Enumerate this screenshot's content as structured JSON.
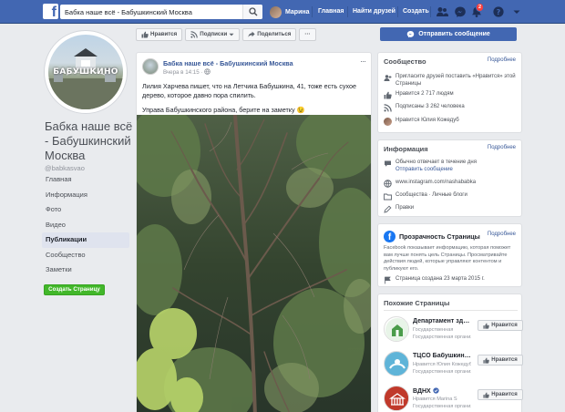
{
  "topbar": {
    "logo": "f",
    "search_value": "Бабка наше всё - Бабушкинский Москва",
    "user_name": "Марина",
    "nav_home": "Главная",
    "nav_find_friends": "Найти друзей",
    "nav_create": "Создать",
    "notifications_count": "2",
    "colors": {
      "bar": "#4267b2",
      "badge": "#fa3e3e"
    }
  },
  "page": {
    "name": "Бабка наше всё - Бабушкинский Москва",
    "handle": "@babkasvao",
    "profile_brand": "БАБУШКИНО",
    "left_nav": [
      {
        "label": "Главная"
      },
      {
        "label": "Информация"
      },
      {
        "label": "Фото"
      },
      {
        "label": "Видео"
      },
      {
        "label": "Публикации",
        "active": true
      },
      {
        "label": "Сообщество"
      },
      {
        "label": "Заметки"
      }
    ],
    "create_page": "Создать Страницу"
  },
  "actions": {
    "like": "Нравится",
    "subscriptions": "Подписки",
    "share": "Поделиться",
    "more": "···",
    "send_message": "Отправить сообщение"
  },
  "post": {
    "author": "Бабка наше всё - Бабушкинский Москва",
    "time": "Вчера в 14:15 ·",
    "text1": "Лилия Харчева пишет, что на Летчика Бабушкина, 41, тоже есть сухое дерево, которое давно пора спилить.",
    "text2": "Управа Бабушкинского района, берите на заметку 😉",
    "more": "···"
  },
  "community": {
    "title": "Сообщество",
    "more": "Подробнее",
    "invite": "Пригласите друзей поставить «Нравится» этой Страницы",
    "likes": "Нравится 2 717 людям",
    "followers": "Подписаны 3 262 человека",
    "liked_by": "Нравится Юлия Кожедуб"
  },
  "info": {
    "title": "Информация",
    "more": "Подробнее",
    "response": "Обычно отвечает в течение дня",
    "send_message": "Отправить сообщение",
    "instagram": "www.instagram.com/nashababka",
    "categories": "Сообщества · Личные блоги",
    "edits": "Правки"
  },
  "transparency": {
    "title": "Прозрачность Страницы",
    "more": "Подробнее",
    "desc": "Facebook показывает информацию, которая поможет вам лучше понять цель Страницы. Просматривайте действия людей, которые управляют контентом и публикуют его.",
    "created": "Страница создана 23 марта 2015 г."
  },
  "similar": {
    "title": "Похожие Страницы",
    "like_label": "Нравится",
    "items": [
      {
        "name": "Департамент здравоохранения",
        "line1": "Государственная",
        "line2": "Государственная организация"
      },
      {
        "name": "ТЦСО Бабушкинский",
        "line1": "Нравится Юлия Кожедуб",
        "line2": "Государственная организация"
      },
      {
        "name": "ВДНХ",
        "line1": "Нравится Marina S",
        "line2": "Государственная организация"
      }
    ]
  }
}
